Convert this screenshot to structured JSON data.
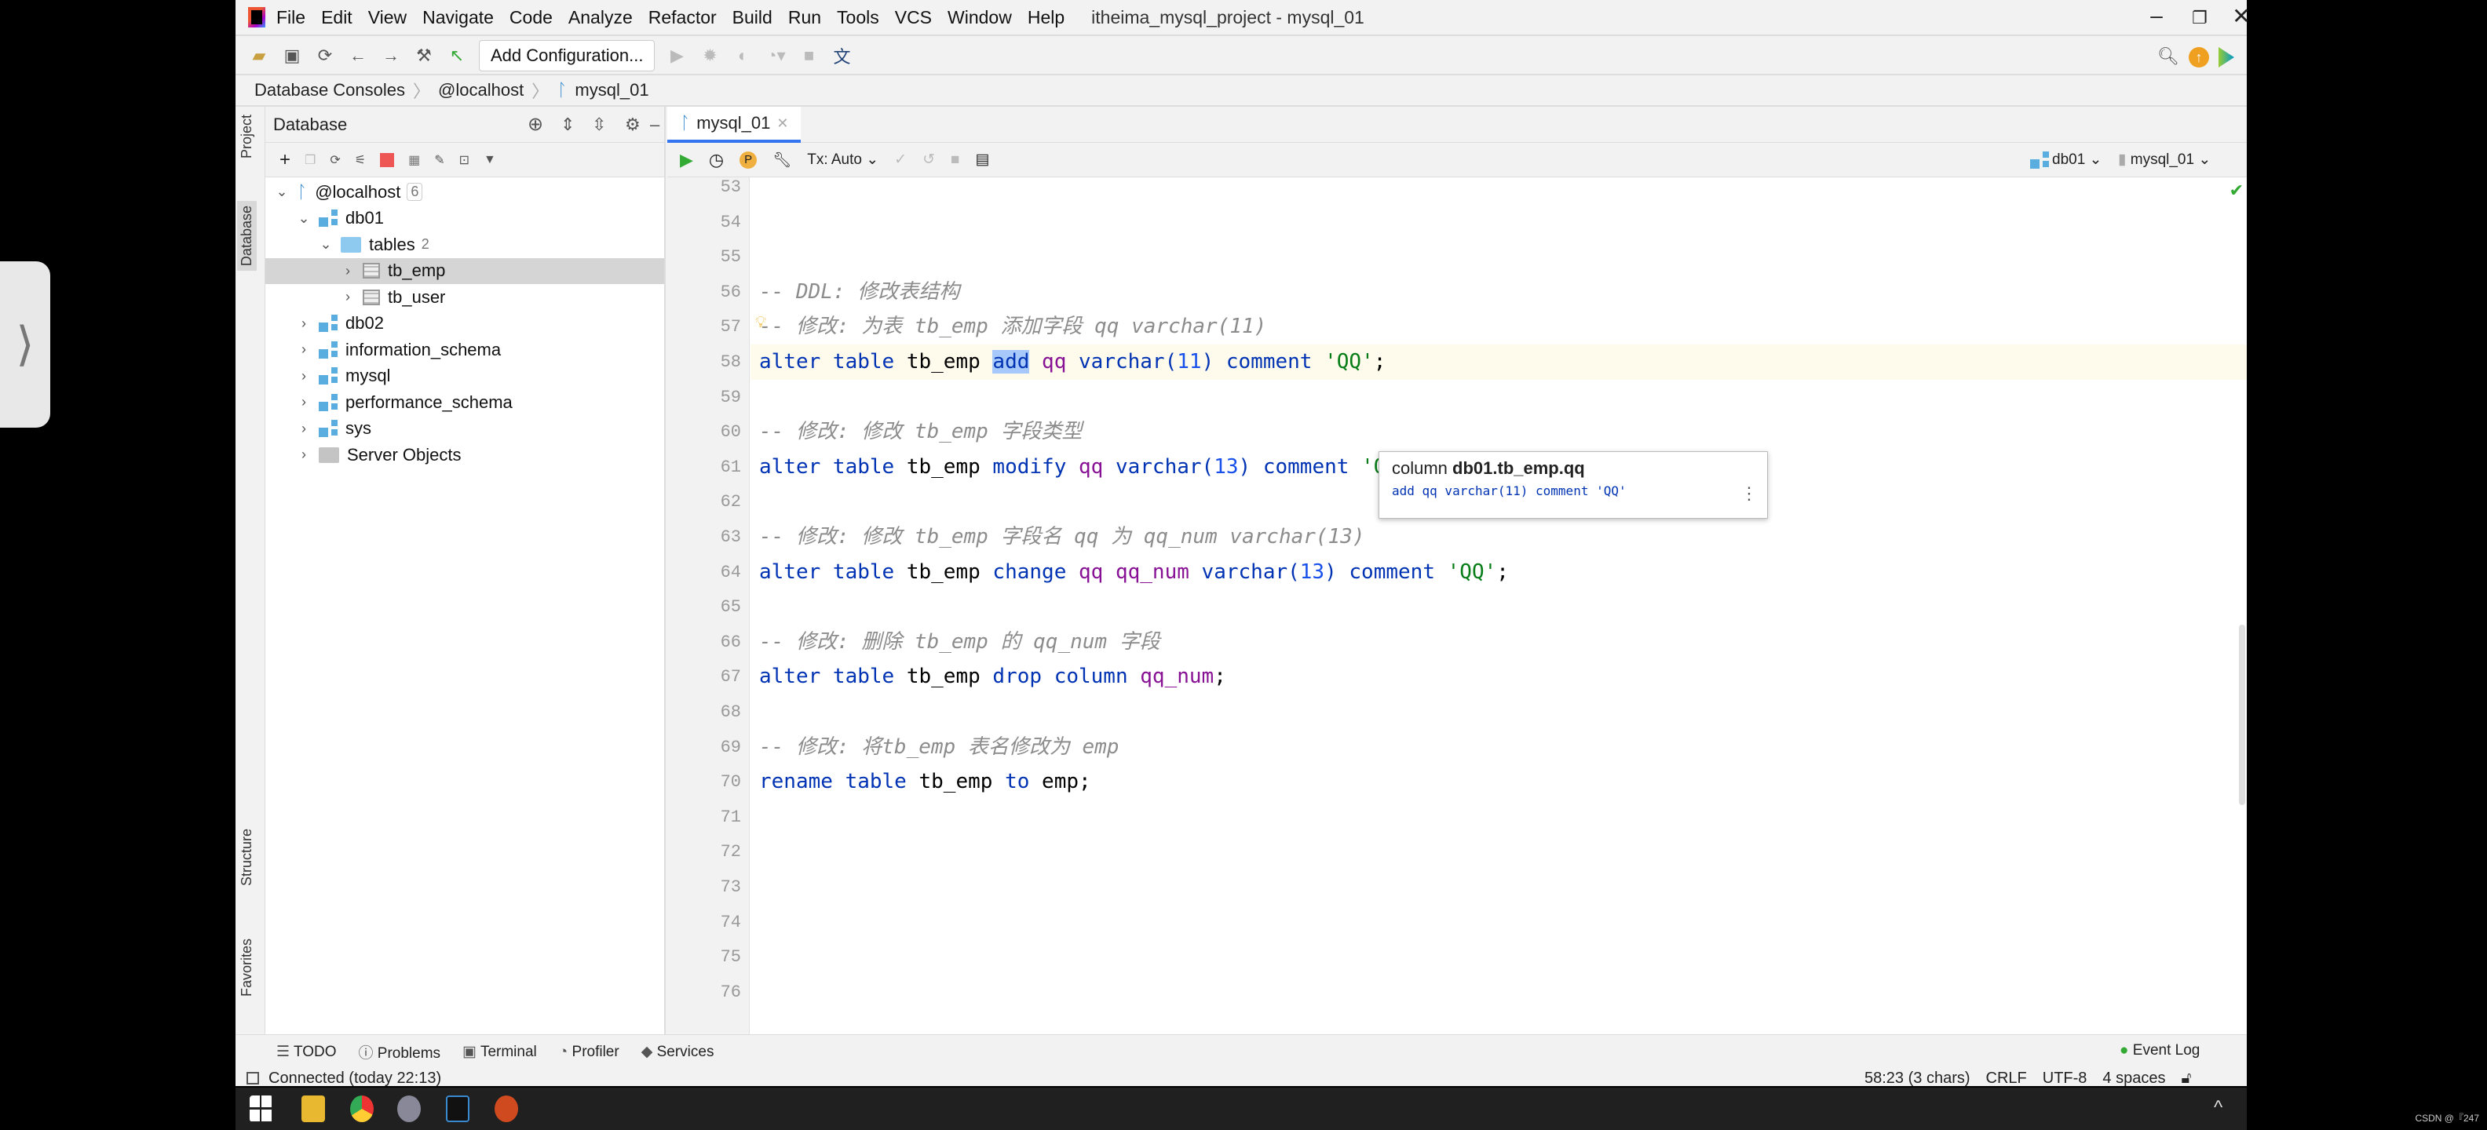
{
  "window": {
    "title": "itheima_mysql_project - mysql_01",
    "menu": [
      "File",
      "Edit",
      "View",
      "Navigate",
      "Code",
      "Analyze",
      "Refactor",
      "Build",
      "Run",
      "Tools",
      "VCS",
      "Window",
      "Help"
    ]
  },
  "toolbar": {
    "add_configuration": "Add Configuration..."
  },
  "breadcrumb": [
    "Database Consoles",
    "@localhost",
    "mysql_01"
  ],
  "left_strip": {
    "project": "Project",
    "database": "Database",
    "structure": "Structure",
    "favorites": "Favorites"
  },
  "panel": {
    "title": "Database",
    "tree": [
      {
        "label": "@localhost",
        "count": "6",
        "expanded": true,
        "icon": "mysql-connection-icon",
        "level": 0
      },
      {
        "label": "db01",
        "expanded": true,
        "icon": "schema-icon",
        "level": 1
      },
      {
        "label": "tables",
        "count": "2",
        "expanded": true,
        "icon": "folder-icon",
        "level": 2
      },
      {
        "label": "tb_emp",
        "icon": "table-icon",
        "level": 3,
        "selected": true
      },
      {
        "label": "tb_user",
        "icon": "table-icon",
        "level": 3
      },
      {
        "label": "db02",
        "icon": "schema-icon",
        "level": 1
      },
      {
        "label": "information_schema",
        "icon": "schema-icon",
        "level": 1
      },
      {
        "label": "mysql",
        "icon": "schema-icon",
        "level": 1
      },
      {
        "label": "performance_schema",
        "icon": "schema-icon",
        "level": 1
      },
      {
        "label": "sys",
        "icon": "schema-icon",
        "level": 1
      },
      {
        "label": "Server Objects",
        "icon": "folder-gray-icon",
        "level": 1
      }
    ]
  },
  "editor": {
    "tab": "mysql_01",
    "tx": "Tx: Auto",
    "schema": "db01",
    "session": "mysql_01",
    "lines": [
      {
        "n": "53",
        "t": []
      },
      {
        "n": "54",
        "t": []
      },
      {
        "n": "55",
        "t": []
      },
      {
        "n": "56",
        "t": [
          [
            "-- DDL: 修改表结构",
            "cm"
          ]
        ]
      },
      {
        "n": "57",
        "t": [
          [
            "-- 修改: 为表 tb_emp 添加字段 qq varchar(11)",
            "cm"
          ]
        ]
      },
      {
        "n": "58",
        "cur": true,
        "t": [
          [
            "alter table ",
            "kw"
          ],
          [
            "tb_emp ",
            "id"
          ],
          [
            "add",
            "kw hl"
          ],
          [
            " ",
            "id"
          ],
          [
            "qq ",
            "col"
          ],
          [
            "varchar(",
            "kw"
          ],
          [
            "11",
            "num"
          ],
          [
            ") ",
            "kw"
          ],
          [
            "comment ",
            "kw"
          ],
          [
            "'QQ'",
            "str"
          ],
          [
            ";",
            "id"
          ]
        ]
      },
      {
        "n": "59",
        "t": []
      },
      {
        "n": "60",
        "t": [
          [
            "-- 修改: 修改 tb_emp 字段类型",
            "cm"
          ]
        ]
      },
      {
        "n": "61",
        "t": [
          [
            "alter table ",
            "kw"
          ],
          [
            "tb_emp ",
            "id"
          ],
          [
            "modify ",
            "kw"
          ],
          [
            "qq ",
            "col"
          ],
          [
            "varchar(",
            "kw"
          ],
          [
            "13",
            "num"
          ],
          [
            ") ",
            "kw"
          ],
          [
            "comment ",
            "kw"
          ],
          [
            "'QQ'",
            "str"
          ],
          [
            ";",
            "id"
          ]
        ]
      },
      {
        "n": "62",
        "t": []
      },
      {
        "n": "63",
        "t": [
          [
            "-- 修改: 修改 tb_emp 字段名 qq 为 qq_num varchar(13)",
            "cm"
          ]
        ]
      },
      {
        "n": "64",
        "t": [
          [
            "alter table ",
            "kw"
          ],
          [
            "tb_emp ",
            "id"
          ],
          [
            "change ",
            "kw"
          ],
          [
            "qq qq_num ",
            "col"
          ],
          [
            "varchar(",
            "kw"
          ],
          [
            "13",
            "num"
          ],
          [
            ") ",
            "kw"
          ],
          [
            "comment ",
            "kw"
          ],
          [
            "'QQ'",
            "str"
          ],
          [
            ";",
            "id"
          ]
        ]
      },
      {
        "n": "65",
        "t": []
      },
      {
        "n": "66",
        "t": [
          [
            "-- 修改: 删除 tb_emp 的 qq_num 字段",
            "cm"
          ]
        ]
      },
      {
        "n": "67",
        "t": [
          [
            "alter table ",
            "kw"
          ],
          [
            "tb_emp ",
            "id"
          ],
          [
            "drop column ",
            "kw"
          ],
          [
            "qq_num",
            "col"
          ],
          [
            ";",
            "id"
          ]
        ]
      },
      {
        "n": "68",
        "t": []
      },
      {
        "n": "69",
        "t": [
          [
            "-- 修改: 将tb_emp 表名修改为 emp",
            "cm"
          ]
        ]
      },
      {
        "n": "70",
        "t": [
          [
            "rename table ",
            "kw"
          ],
          [
            "tb_emp ",
            "id"
          ],
          [
            "to ",
            "kw"
          ],
          [
            "emp;",
            "id"
          ]
        ]
      },
      {
        "n": "71",
        "t": []
      },
      {
        "n": "72",
        "t": []
      },
      {
        "n": "73",
        "t": []
      },
      {
        "n": "74",
        "t": []
      },
      {
        "n": "75",
        "t": []
      },
      {
        "n": "76",
        "t": []
      }
    ],
    "popup": {
      "prefix": "column ",
      "name": "db01.tb_emp.qq",
      "signature": "add qq varchar(11) comment 'QQ'"
    }
  },
  "bottom_tools": [
    "TODO",
    "Problems",
    "Terminal",
    "Profiler",
    "Services"
  ],
  "event_log": "Event Log",
  "status": {
    "connection": "Connected (today 22:13)",
    "position": "58:23 (3 chars)",
    "line_sep": "CRLF",
    "encoding": "UTF-8",
    "indent": "4 spaces"
  },
  "watermark": "CSDN @『247"
}
